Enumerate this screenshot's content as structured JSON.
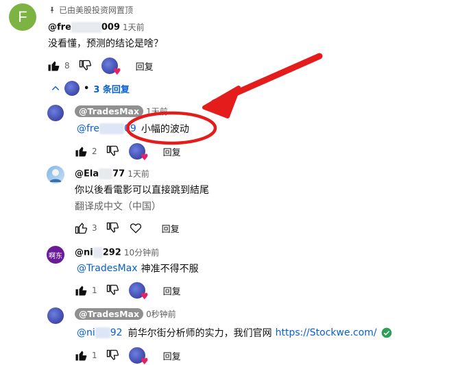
{
  "pinned": {
    "avatar_letter": "F",
    "pin_label": "已由美股投资网置顶",
    "handle_prefix": "@fre",
    "handle_suffix": "009",
    "time": "1天前",
    "text": "没看懂，预测的结论是啥？",
    "likes": "8",
    "reply_label": "回复"
  },
  "replies_toggle": {
    "label": "3 条回复",
    "dot": "•"
  },
  "replies": [
    {
      "handle": "@TradesMax",
      "time": "1天前",
      "mention_prefix": "@fre",
      "mention_suffix": "09",
      "text": "小幅的波动",
      "likes": "2",
      "reply_label": "回复"
    },
    {
      "handle_prefix": "@Ela",
      "handle_suffix": "77",
      "time": "1天前",
      "text": "你以後看電影可以直接跳到結尾",
      "translate_label": "翻译成中文（中国）",
      "likes": "3",
      "reply_label": "回复"
    },
    {
      "avatar_text": "啊东",
      "handle_prefix": "@ni",
      "handle_suffix": "292",
      "time": "10分钟前",
      "mention": "@TradesMax",
      "text": "神准不得不服",
      "likes": "1",
      "reply_label": "回复"
    },
    {
      "handle": "@TradesMax",
      "time": "0秒钟前",
      "mention_prefix": "@ni",
      "mention_suffix": "92",
      "text": "前华尔街分析师的实力，我们官网",
      "link": "https://Stockwe.com/",
      "likes": "1",
      "reply_label": "回复"
    }
  ],
  "colors": {
    "accent": "#065fd4",
    "annotation_red": "#e41c1c",
    "avatar_green": "#7cb342",
    "avatar_purple": "#6a1b9a",
    "heart": "#e91e63"
  },
  "icons": [
    "pin-icon",
    "thumb-up-icon",
    "thumb-down-icon",
    "heart-icon",
    "chevron-up-icon",
    "check-circle-icon",
    "red-arrow-annotation",
    "red-ellipse-annotation"
  ]
}
